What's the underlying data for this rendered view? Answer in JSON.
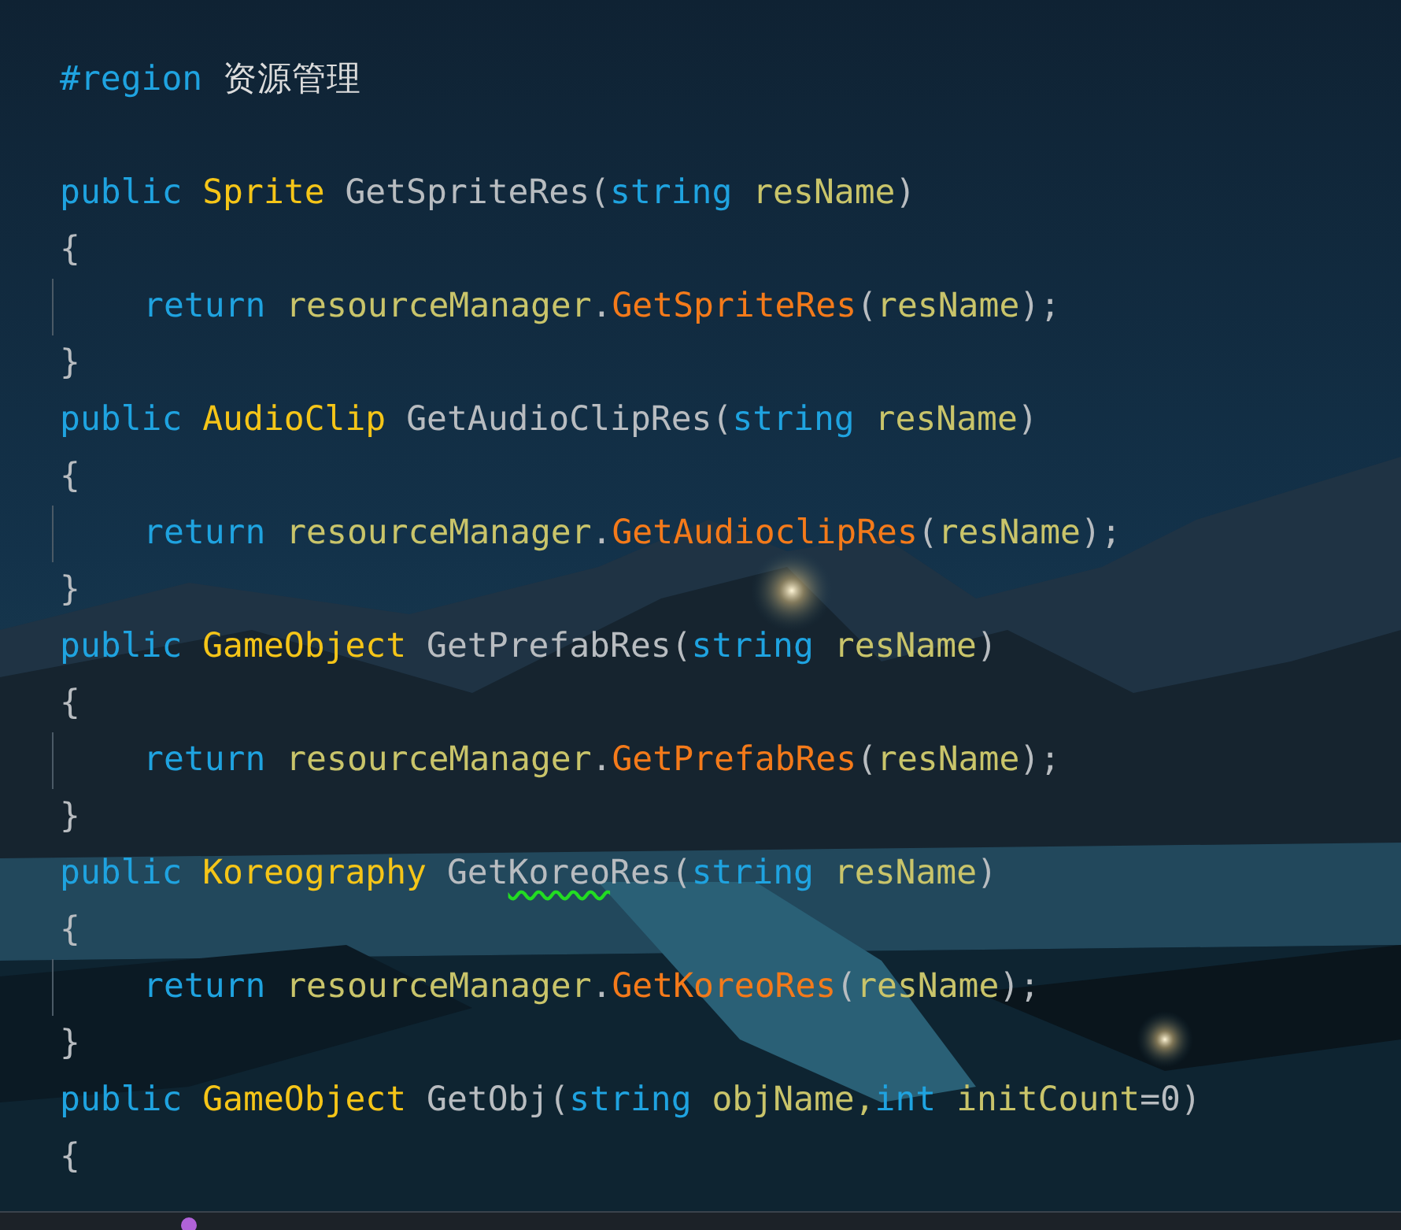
{
  "editor": {
    "lines": [
      {
        "kind": "code",
        "indented": false,
        "tokens": [
          {
            "text": "#region",
            "kind": "keyword"
          },
          {
            "text": " 资源管理",
            "kind": "text"
          }
        ]
      },
      {
        "kind": "blank"
      },
      {
        "kind": "code",
        "indented": false,
        "tokens": [
          {
            "text": "public",
            "kind": "keyword"
          },
          {
            "text": " Sprite",
            "kind": "type"
          },
          {
            "text": " GetSpriteRes(",
            "kind": "method"
          },
          {
            "text": "string",
            "kind": "keyword"
          },
          {
            "text": " resName",
            "kind": "ident"
          },
          {
            "text": ")",
            "kind": "punct"
          }
        ]
      },
      {
        "kind": "code",
        "indented": false,
        "tokens": [
          {
            "text": "{",
            "kind": "punct"
          }
        ]
      },
      {
        "kind": "code",
        "indented": true,
        "tokens": [
          {
            "text": "return",
            "kind": "keyword"
          },
          {
            "text": " resourceManager",
            "kind": "ident"
          },
          {
            "text": ".",
            "kind": "punct"
          },
          {
            "text": "GetSpriteRes",
            "kind": "call"
          },
          {
            "text": "(",
            "kind": "punct"
          },
          {
            "text": "resName",
            "kind": "ident"
          },
          {
            "text": ");",
            "kind": "punct"
          }
        ]
      },
      {
        "kind": "code",
        "indented": false,
        "tokens": [
          {
            "text": "}",
            "kind": "punct"
          }
        ]
      },
      {
        "kind": "code",
        "indented": false,
        "tokens": [
          {
            "text": "public",
            "kind": "keyword"
          },
          {
            "text": " AudioClip",
            "kind": "type"
          },
          {
            "text": " GetAudioClipRes(",
            "kind": "method"
          },
          {
            "text": "string",
            "kind": "keyword"
          },
          {
            "text": " resName",
            "kind": "ident"
          },
          {
            "text": ")",
            "kind": "punct"
          }
        ]
      },
      {
        "kind": "code",
        "indented": false,
        "tokens": [
          {
            "text": "{",
            "kind": "punct"
          }
        ]
      },
      {
        "kind": "code",
        "indented": true,
        "tokens": [
          {
            "text": "return",
            "kind": "keyword"
          },
          {
            "text": " resourceManager",
            "kind": "ident"
          },
          {
            "text": ".",
            "kind": "punct"
          },
          {
            "text": "GetAudioclipRes",
            "kind": "call"
          },
          {
            "text": "(",
            "kind": "punct"
          },
          {
            "text": "resName",
            "kind": "ident"
          },
          {
            "text": ");",
            "kind": "punct"
          }
        ]
      },
      {
        "kind": "code",
        "indented": false,
        "tokens": [
          {
            "text": "}",
            "kind": "punct"
          }
        ]
      },
      {
        "kind": "code",
        "indented": false,
        "tokens": [
          {
            "text": "public",
            "kind": "keyword"
          },
          {
            "text": " GameObject",
            "kind": "type"
          },
          {
            "text": " GetPrefabRes(",
            "kind": "method"
          },
          {
            "text": "string",
            "kind": "keyword"
          },
          {
            "text": " resName",
            "kind": "ident"
          },
          {
            "text": ")",
            "kind": "punct"
          }
        ]
      },
      {
        "kind": "code",
        "indented": false,
        "tokens": [
          {
            "text": "{",
            "kind": "punct"
          }
        ]
      },
      {
        "kind": "code",
        "indented": true,
        "tokens": [
          {
            "text": "return",
            "kind": "keyword"
          },
          {
            "text": " resourceManager",
            "kind": "ident"
          },
          {
            "text": ".",
            "kind": "punct"
          },
          {
            "text": "GetPrefabRes",
            "kind": "call"
          },
          {
            "text": "(",
            "kind": "punct"
          },
          {
            "text": "resName",
            "kind": "ident"
          },
          {
            "text": ");",
            "kind": "punct"
          }
        ]
      },
      {
        "kind": "code",
        "indented": false,
        "tokens": [
          {
            "text": "}",
            "kind": "punct"
          }
        ]
      },
      {
        "kind": "code",
        "indented": false,
        "tokens": [
          {
            "text": "public",
            "kind": "keyword"
          },
          {
            "text": " Koreography",
            "kind": "type"
          },
          {
            "text": " Get",
            "kind": "method"
          },
          {
            "text": "Koreo",
            "kind": "method",
            "squiggle": true
          },
          {
            "text": "Res(",
            "kind": "method"
          },
          {
            "text": "string",
            "kind": "keyword"
          },
          {
            "text": " resName",
            "kind": "ident"
          },
          {
            "text": ")",
            "kind": "punct"
          }
        ]
      },
      {
        "kind": "code",
        "indented": false,
        "tokens": [
          {
            "text": "{",
            "kind": "punct"
          }
        ]
      },
      {
        "kind": "code",
        "indented": true,
        "tokens": [
          {
            "text": "return",
            "kind": "keyword"
          },
          {
            "text": " resourceManager",
            "kind": "ident"
          },
          {
            "text": ".",
            "kind": "punct"
          },
          {
            "text": "GetKoreoRes",
            "kind": "call"
          },
          {
            "text": "(",
            "kind": "punct"
          },
          {
            "text": "resName",
            "kind": "ident"
          },
          {
            "text": ");",
            "kind": "punct"
          }
        ]
      },
      {
        "kind": "code",
        "indented": false,
        "tokens": [
          {
            "text": "}",
            "kind": "punct"
          }
        ]
      },
      {
        "kind": "code",
        "indented": false,
        "tokens": [
          {
            "text": "public",
            "kind": "keyword"
          },
          {
            "text": " GameObject",
            "kind": "type"
          },
          {
            "text": " GetObj(",
            "kind": "method"
          },
          {
            "text": "string",
            "kind": "keyword"
          },
          {
            "text": " objName,",
            "kind": "ident"
          },
          {
            "text": "int",
            "kind": "keyword"
          },
          {
            "text": " initCount",
            "kind": "ident"
          },
          {
            "text": "=0)",
            "kind": "punct"
          }
        ]
      },
      {
        "kind": "code",
        "indented": false,
        "tokens": [
          {
            "text": "{",
            "kind": "punct"
          }
        ]
      }
    ]
  }
}
